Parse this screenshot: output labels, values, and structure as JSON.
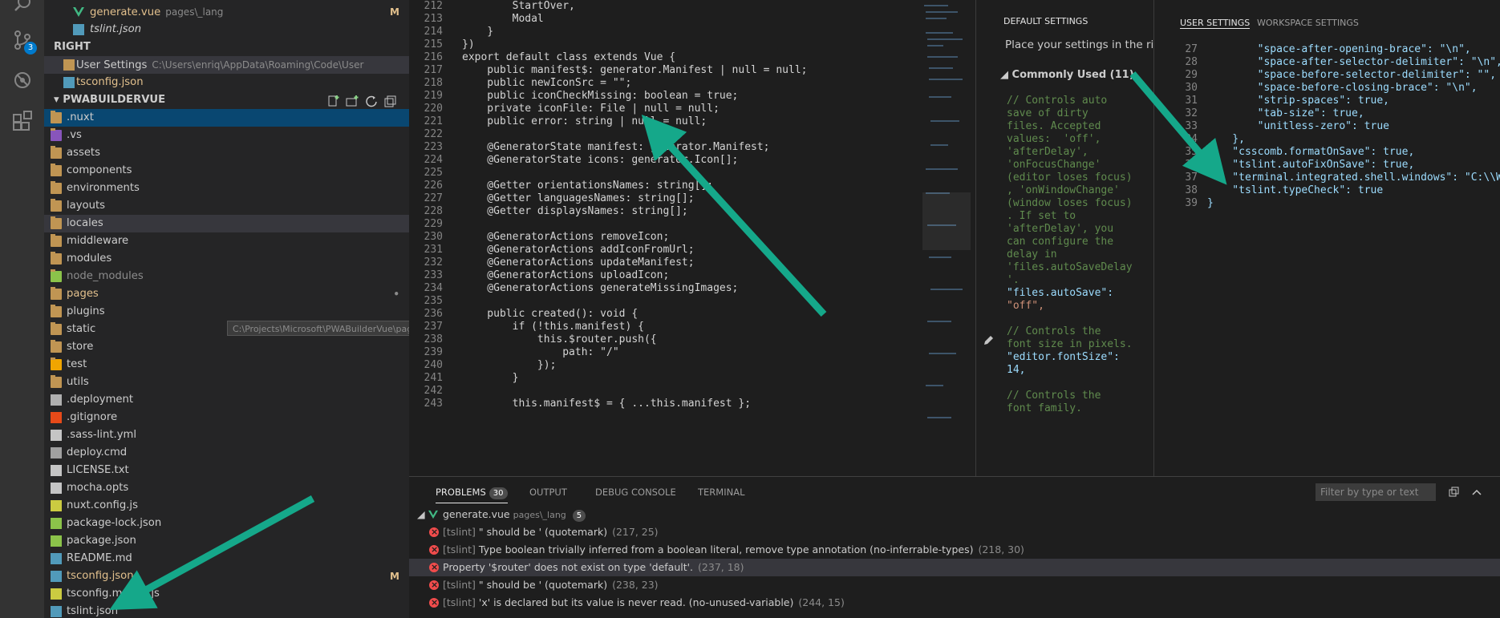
{
  "activity_bar": {
    "scm_badge": "3",
    "icons": [
      "search-icon",
      "source-control-icon",
      "debug-icon",
      "extensions-icon"
    ]
  },
  "explorer": {
    "open_editors": [
      {
        "name": "generate.vue",
        "desc": "pages\\_lang",
        "mark": "M",
        "icon": "vue-icon"
      },
      {
        "name": "tslint.json",
        "desc": "",
        "mark": "",
        "icon": "ts-json-icon"
      }
    ],
    "group_right": "RIGHT",
    "right_editors": [
      {
        "name": "User Settings",
        "desc": "C:\\Users\\enriq\\AppData\\Roaming\\Code\\User",
        "mark": ""
      },
      {
        "name": "tsconfig.json",
        "desc": "",
        "mark": ""
      }
    ],
    "project_title": "PWABUILDERVUE",
    "files": [
      {
        "name": ".nuxt",
        "type": "folder",
        "mark": ""
      },
      {
        "name": ".vs",
        "type": "folder",
        "mark": ""
      },
      {
        "name": "assets",
        "type": "folder",
        "mark": ""
      },
      {
        "name": "components",
        "type": "folder",
        "mark": ""
      },
      {
        "name": "environments",
        "type": "folder",
        "mark": ""
      },
      {
        "name": "layouts",
        "type": "folder",
        "mark": ""
      },
      {
        "name": "locales",
        "type": "folder",
        "mark": ""
      },
      {
        "name": "middleware",
        "type": "folder",
        "mark": ""
      },
      {
        "name": "modules",
        "type": "folder",
        "mark": ""
      },
      {
        "name": "node_modules",
        "type": "folder",
        "mark": ""
      },
      {
        "name": "pages",
        "type": "folder",
        "mark": "•"
      },
      {
        "name": "plugins",
        "type": "folder",
        "mark": ""
      },
      {
        "name": "static",
        "type": "folder",
        "mark": ""
      },
      {
        "name": "store",
        "type": "folder",
        "mark": ""
      },
      {
        "name": "test",
        "type": "folder",
        "mark": ""
      },
      {
        "name": "utils",
        "type": "folder",
        "mark": ""
      },
      {
        "name": ".deployment",
        "type": "file",
        "mark": ""
      },
      {
        "name": ".gitignore",
        "type": "file",
        "mark": ""
      },
      {
        "name": ".sass-lint.yml",
        "type": "file",
        "mark": ""
      },
      {
        "name": "deploy.cmd",
        "type": "file",
        "mark": ""
      },
      {
        "name": "LICENSE.txt",
        "type": "file",
        "mark": ""
      },
      {
        "name": "mocha.opts",
        "type": "file",
        "mark": ""
      },
      {
        "name": "nuxt.config.js",
        "type": "file",
        "mark": ""
      },
      {
        "name": "package-lock.json",
        "type": "file",
        "mark": ""
      },
      {
        "name": "package.json",
        "type": "file",
        "mark": ""
      },
      {
        "name": "README.md",
        "type": "file",
        "mark": ""
      },
      {
        "name": "tsconfig.json",
        "type": "file",
        "mark": "M"
      },
      {
        "name": "tsconfig.mocha.js",
        "type": "file",
        "mark": ""
      },
      {
        "name": "tslint.json",
        "type": "file",
        "mark": ""
      }
    ],
    "tooltip": "C:\\Projects\\Microsoft\\PWABuilderVue\\pages • Contains emphasized items"
  },
  "editor": {
    "lines": [
      {
        "n": "212",
        "t": "        StartOver,"
      },
      {
        "n": "213",
        "t": "        Modal"
      },
      {
        "n": "214",
        "t": "    }"
      },
      {
        "n": "215",
        "t": "})"
      },
      {
        "n": "216",
        "t": "export default class extends Vue {"
      },
      {
        "n": "217",
        "t": "    public manifest$: generator.Manifest | null = null;"
      },
      {
        "n": "218",
        "t": "    public newIconSrc = \"\";"
      },
      {
        "n": "219",
        "t": "    public iconCheckMissing: boolean = true;"
      },
      {
        "n": "220",
        "t": "    private iconFile: File | null = null;"
      },
      {
        "n": "221",
        "t": "    public error: string | null = null;"
      },
      {
        "n": "222",
        "t": ""
      },
      {
        "n": "223",
        "t": "    @GeneratorState manifest: generator.Manifest;"
      },
      {
        "n": "224",
        "t": "    @GeneratorState icons: generator.Icon[];"
      },
      {
        "n": "225",
        "t": ""
      },
      {
        "n": "226",
        "t": "    @Getter orientationsNames: string[];"
      },
      {
        "n": "227",
        "t": "    @Getter languagesNames: string[];"
      },
      {
        "n": "228",
        "t": "    @Getter displaysNames: string[];"
      },
      {
        "n": "229",
        "t": ""
      },
      {
        "n": "230",
        "t": "    @GeneratorActions removeIcon;"
      },
      {
        "n": "231",
        "t": "    @GeneratorActions addIconFromUrl;"
      },
      {
        "n": "232",
        "t": "    @GeneratorActions updateManifest;"
      },
      {
        "n": "233",
        "t": "    @GeneratorActions uploadIcon;"
      },
      {
        "n": "234",
        "t": "    @GeneratorActions generateMissingImages;"
      },
      {
        "n": "235",
        "t": ""
      },
      {
        "n": "236",
        "t": "    public created(): void {"
      },
      {
        "n": "237",
        "t": "        if (!this.manifest) {"
      },
      {
        "n": "238",
        "t": "            this.$router.push({"
      },
      {
        "n": "239",
        "t": "                path: \"/\""
      },
      {
        "n": "240",
        "t": "            });"
      },
      {
        "n": "241",
        "t": "        }"
      },
      {
        "n": "242",
        "t": ""
      },
      {
        "n": "243",
        "t": "        this.manifest$ = { ...this.manifest };"
      }
    ]
  },
  "settings": {
    "default_title": "DEFAULT SETTINGS",
    "user_tab": "USER SETTINGS",
    "workspace_tab": "WORKSPACE SETTINGS",
    "place_text": "Place your settings in the righ",
    "commonly_used": "Commonly Used (11)",
    "default_lines": [
      "// Controls auto",
      "save of dirty",
      "files. Accepted",
      "values:  'off',",
      "'afterDelay',",
      "'onFocusChange'",
      "(editor loses focus)",
      ", 'onWindowChange'",
      "(window loses focus)",
      ". If set to",
      "'afterDelay', you",
      "can configure the",
      "delay in",
      "'files.autoSaveDelay",
      "'.",
      "\"files.autoSave\":",
      "\"off\",",
      "",
      "// Controls the",
      "font size in pixels.",
      "\"editor.fontSize\":",
      "14,",
      "",
      "// Controls the",
      "font family."
    ],
    "user_lines": [
      {
        "n": "27",
        "t": "        \"space-after-opening-brace\": \"\\n\","
      },
      {
        "n": "28",
        "t": "        \"space-after-selector-delimiter\": \"\\n\","
      },
      {
        "n": "29",
        "t": "        \"space-before-selector-delimiter\": \"\","
      },
      {
        "n": "30",
        "t": "        \"space-before-closing-brace\": \"\\n\","
      },
      {
        "n": "31",
        "t": "        \"strip-spaces\": true,"
      },
      {
        "n": "32",
        "t": "        \"tab-size\": true,"
      },
      {
        "n": "33",
        "t": "        \"unitless-zero\": true"
      },
      {
        "n": "34",
        "t": "    },"
      },
      {
        "n": "35",
        "t": "    \"csscomb.formatOnSave\": true,"
      },
      {
        "n": "36",
        "t": "    \"tslint.autoFixOnSave\": true,"
      },
      {
        "n": "37",
        "t": "    \"terminal.integrated.shell.windows\": \"C:\\\\W"
      },
      {
        "n": "38",
        "t": "    \"tslint.typeCheck\": true"
      },
      {
        "n": "39",
        "t": "}"
      }
    ]
  },
  "panel": {
    "tabs": [
      {
        "label": "PROBLEMS",
        "badge": "30"
      },
      {
        "label": "OUTPUT",
        "badge": ""
      },
      {
        "label": "DEBUG CONSOLE",
        "badge": ""
      },
      {
        "label": "TERMINAL",
        "badge": ""
      }
    ],
    "filter_placeholder": "Filter by type or text",
    "file_group": {
      "name": "generate.vue",
      "path": "pages\\_lang",
      "count": "5"
    },
    "problems": [
      {
        "source": "[tslint]",
        "msg": " \" should be ' (quotemark)",
        "pos": "(217, 25)"
      },
      {
        "source": "[tslint]",
        "msg": " Type boolean trivially inferred from a boolean literal, remove type annotation (no-inferrable-types)",
        "pos": "(218, 30)"
      },
      {
        "source": "",
        "msg": "Property '$router' does not exist on type 'default'.",
        "pos": "(237, 18)"
      },
      {
        "source": "[tslint]",
        "msg": " \" should be ' (quotemark)",
        "pos": "(238, 23)"
      },
      {
        "source": "[tslint]",
        "msg": " 'x' is declared but its value is never read. (no-unused-variable)",
        "pos": "(244, 15)"
      }
    ]
  },
  "colors": {
    "accent": "#007acc",
    "arrow": "#15a88a",
    "error": "#f14c4c",
    "modified": "#e2c08d"
  }
}
